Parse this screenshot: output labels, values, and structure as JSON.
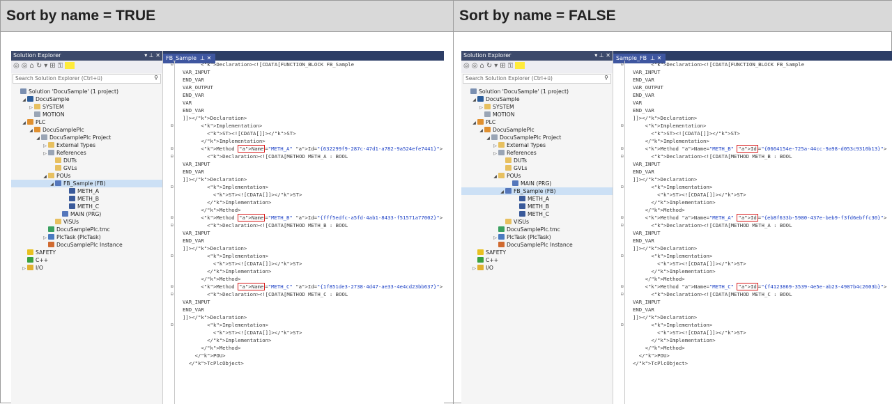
{
  "left": {
    "header": "Sort by name = TRUE",
    "explorer": {
      "title": "Solution Explorer",
      "title_controls": "▾ ⊥ ✕",
      "search_placeholder": "Search Solution Explorer (Ctrl+ü)",
      "items": [
        {
          "label": "Solution 'DocuSample' (1 project)",
          "indent": 0,
          "arrow": "",
          "icon": "solution-icon",
          "cls": "ic-sol"
        },
        {
          "label": "DocuSample",
          "indent": 1,
          "arrow": "◢",
          "icon": "project-icon",
          "cls": "ic-proj"
        },
        {
          "label": "SYSTEM",
          "indent": 2,
          "arrow": "▷",
          "icon": "system-icon",
          "cls": "ic-fold"
        },
        {
          "label": "MOTION",
          "indent": 2,
          "arrow": "",
          "icon": "motion-icon",
          "cls": "ic-gray"
        },
        {
          "label": "PLC",
          "indent": 1,
          "arrow": "◢",
          "icon": "plc-icon",
          "cls": "ic-plc"
        },
        {
          "label": "DocuSamplePlc",
          "indent": 2,
          "arrow": "◢",
          "icon": "plc-project-icon",
          "cls": "ic-plc"
        },
        {
          "label": "DocuSamplePlc Project",
          "indent": 3,
          "arrow": "◢",
          "icon": "project-file-icon",
          "cls": "ic-gray"
        },
        {
          "label": "External Types",
          "indent": 4,
          "arrow": "▷",
          "icon": "folder-icon",
          "cls": "ic-fold"
        },
        {
          "label": "References",
          "indent": 4,
          "arrow": "▷",
          "icon": "references-icon",
          "cls": "ic-gray"
        },
        {
          "label": "DUTs",
          "indent": 5,
          "arrow": "",
          "icon": "folder-icon",
          "cls": "ic-fold"
        },
        {
          "label": "GVLs",
          "indent": 5,
          "arrow": "",
          "icon": "folder-icon",
          "cls": "ic-fold"
        },
        {
          "label": "POUs",
          "indent": 4,
          "arrow": "◢",
          "icon": "folder-open-icon",
          "cls": "ic-fold"
        },
        {
          "label": "FB_Sample (FB)",
          "indent": 5,
          "arrow": "◢",
          "icon": "function-block-icon",
          "cls": "ic-fb",
          "selected": true
        },
        {
          "label": "METH_A",
          "indent": 7,
          "arrow": "",
          "icon": "method-icon",
          "cls": "ic-m"
        },
        {
          "label": "METH_B",
          "indent": 7,
          "arrow": "",
          "icon": "method-icon",
          "cls": "ic-m"
        },
        {
          "label": "METH_C",
          "indent": 7,
          "arrow": "",
          "icon": "method-icon",
          "cls": "ic-m"
        },
        {
          "label": "MAIN (PRG)",
          "indent": 6,
          "arrow": "",
          "icon": "program-icon",
          "cls": "ic-fb"
        },
        {
          "label": "VISUs",
          "indent": 5,
          "arrow": "",
          "icon": "folder-icon",
          "cls": "ic-fold"
        },
        {
          "label": "DocuSamplePlc.tmc",
          "indent": 4,
          "arrow": "",
          "icon": "tmc-icon",
          "cls": "ic-tmc"
        },
        {
          "label": "PlcTask (PlcTask)",
          "indent": 4,
          "arrow": "▷",
          "icon": "task-icon",
          "cls": "ic-task"
        },
        {
          "label": "DocuSamplePlc Instance",
          "indent": 4,
          "arrow": "",
          "icon": "instance-icon",
          "cls": "ic-inst"
        },
        {
          "label": "SAFETY",
          "indent": 1,
          "arrow": "",
          "icon": "safety-icon",
          "cls": "ic-safe"
        },
        {
          "label": "C++",
          "indent": 1,
          "arrow": "",
          "icon": "cpp-icon",
          "cls": "ic-cpp"
        },
        {
          "label": "I/O",
          "indent": 1,
          "arrow": "▷",
          "icon": "io-icon",
          "cls": "ic-io"
        }
      ]
    },
    "editor": {
      "tab": "FB_Sample",
      "tab_controls": "⊥ ✕",
      "lines": [
        {
          "t": "      <Declaration><![CDATA[FUNCTION_BLOCK FB_Sample",
          "m": "⊟"
        },
        {
          "t": "VAR_INPUT",
          "m": ""
        },
        {
          "t": "END_VAR",
          "m": ""
        },
        {
          "t": "VAR_OUTPUT",
          "m": ""
        },
        {
          "t": "END_VAR",
          "m": ""
        },
        {
          "t": "VAR",
          "m": ""
        },
        {
          "t": "END_VAR",
          "m": ""
        },
        {
          "t": "]]></Declaration>",
          "m": ""
        },
        {
          "t": "      <Implementation>",
          "m": "⊟"
        },
        {
          "t": "        <ST><![CDATA[]]></ST>",
          "m": ""
        },
        {
          "t": "      </Implementation>",
          "m": ""
        },
        {
          "t": "      <Method Name=\"METH_A\" Id=\"{632299f9-287c-47d1-a782-9a524efe7441}\">",
          "m": "⊟",
          "box": "Name=\"METH_A\""
        },
        {
          "t": "        <Declaration><![CDATA[METHOD METH_A : BOOL",
          "m": "⊟"
        },
        {
          "t": "VAR_INPUT",
          "m": ""
        },
        {
          "t": "END_VAR",
          "m": ""
        },
        {
          "t": "]]></Declaration>",
          "m": ""
        },
        {
          "t": "        <Implementation>",
          "m": "⊟"
        },
        {
          "t": "          <ST><![CDATA[]]></ST>",
          "m": ""
        },
        {
          "t": "        </Implementation>",
          "m": ""
        },
        {
          "t": "      </Method>",
          "m": ""
        },
        {
          "t": "      <Method Name=\"METH_B\" Id=\"{fff5edfc-a5fd-4ab1-8433-f51571a77002}\">",
          "m": "⊟",
          "box": "Name=\"METH_B\""
        },
        {
          "t": "        <Declaration><![CDATA[METHOD METH_B : BOOL",
          "m": "⊟"
        },
        {
          "t": "VAR_INPUT",
          "m": ""
        },
        {
          "t": "END_VAR",
          "m": ""
        },
        {
          "t": "]]></Declaration>",
          "m": ""
        },
        {
          "t": "        <Implementation>",
          "m": "⊟"
        },
        {
          "t": "          <ST><![CDATA[]]></ST>",
          "m": ""
        },
        {
          "t": "        </Implementation>",
          "m": ""
        },
        {
          "t": "      </Method>",
          "m": ""
        },
        {
          "t": "      <Method Name=\"METH_C\" Id=\"{1f851de3-2738-4d47-ae33-4e4cd23bb637}\">",
          "m": "⊟",
          "box": "Name=\"METH_C\""
        },
        {
          "t": "        <Declaration><![CDATA[METHOD METH_C : BOOL",
          "m": "⊟"
        },
        {
          "t": "VAR_INPUT",
          "m": ""
        },
        {
          "t": "END_VAR",
          "m": ""
        },
        {
          "t": "]]></Declaration>",
          "m": ""
        },
        {
          "t": "        <Implementation>",
          "m": "⊟"
        },
        {
          "t": "          <ST><![CDATA[]]></ST>",
          "m": ""
        },
        {
          "t": "        </Implementation>",
          "m": ""
        },
        {
          "t": "      </Method>",
          "m": ""
        },
        {
          "t": "    </POU>",
          "m": ""
        },
        {
          "t": "  </TcPlcObject>",
          "m": ""
        }
      ]
    }
  },
  "right": {
    "header": "Sort by name = FALSE",
    "explorer": {
      "title": "Solution Explorer",
      "title_controls": "▾ ⊥ ✕",
      "search_placeholder": "Search Solution Explorer (Ctrl+ü)",
      "items": [
        {
          "label": "Solution 'DocuSample' (1 project)",
          "indent": 0,
          "arrow": "",
          "icon": "solution-icon",
          "cls": "ic-sol"
        },
        {
          "label": "DocuSample",
          "indent": 1,
          "arrow": "◢",
          "icon": "project-icon",
          "cls": "ic-proj"
        },
        {
          "label": "SYSTEM",
          "indent": 2,
          "arrow": "▷",
          "icon": "system-icon",
          "cls": "ic-fold"
        },
        {
          "label": "MOTION",
          "indent": 2,
          "arrow": "",
          "icon": "motion-icon",
          "cls": "ic-gray"
        },
        {
          "label": "PLC",
          "indent": 1,
          "arrow": "◢",
          "icon": "plc-icon",
          "cls": "ic-plc"
        },
        {
          "label": "DocuSamplePlc",
          "indent": 2,
          "arrow": "◢",
          "icon": "plc-project-icon",
          "cls": "ic-plc"
        },
        {
          "label": "DocuSamplePlc Project",
          "indent": 3,
          "arrow": "◢",
          "icon": "project-file-icon",
          "cls": "ic-gray"
        },
        {
          "label": "External Types",
          "indent": 4,
          "arrow": "▷",
          "icon": "folder-icon",
          "cls": "ic-fold"
        },
        {
          "label": "References",
          "indent": 4,
          "arrow": "▷",
          "icon": "references-icon",
          "cls": "ic-gray"
        },
        {
          "label": "DUTs",
          "indent": 5,
          "arrow": "",
          "icon": "folder-icon",
          "cls": "ic-fold"
        },
        {
          "label": "GVLs",
          "indent": 5,
          "arrow": "",
          "icon": "folder-icon",
          "cls": "ic-fold"
        },
        {
          "label": "POUs",
          "indent": 4,
          "arrow": "◢",
          "icon": "folder-open-icon",
          "cls": "ic-fold"
        },
        {
          "label": "MAIN (PRG)",
          "indent": 6,
          "arrow": "",
          "icon": "program-icon",
          "cls": "ic-fb"
        },
        {
          "label": "FB_Sample (FB)",
          "indent": 5,
          "arrow": "◢",
          "icon": "function-block-icon",
          "cls": "ic-fb",
          "selected": true
        },
        {
          "label": "METH_A",
          "indent": 7,
          "arrow": "",
          "icon": "method-icon",
          "cls": "ic-m"
        },
        {
          "label": "METH_B",
          "indent": 7,
          "arrow": "",
          "icon": "method-icon",
          "cls": "ic-m"
        },
        {
          "label": "METH_C",
          "indent": 7,
          "arrow": "",
          "icon": "method-icon",
          "cls": "ic-m"
        },
        {
          "label": "VISUs",
          "indent": 5,
          "arrow": "",
          "icon": "folder-icon",
          "cls": "ic-fold"
        },
        {
          "label": "DocuSamplePlc.tmc",
          "indent": 4,
          "arrow": "",
          "icon": "tmc-icon",
          "cls": "ic-tmc"
        },
        {
          "label": "PlcTask (PlcTask)",
          "indent": 4,
          "arrow": "▷",
          "icon": "task-icon",
          "cls": "ic-task"
        },
        {
          "label": "DocuSamplePlc Instance",
          "indent": 4,
          "arrow": "",
          "icon": "instance-icon",
          "cls": "ic-inst"
        },
        {
          "label": "SAFETY",
          "indent": 1,
          "arrow": "",
          "icon": "safety-icon",
          "cls": "ic-safe"
        },
        {
          "label": "C++",
          "indent": 1,
          "arrow": "",
          "icon": "cpp-icon",
          "cls": "ic-cpp"
        },
        {
          "label": "I/O",
          "indent": 1,
          "arrow": "▷",
          "icon": "io-icon",
          "cls": "ic-io"
        }
      ]
    },
    "editor": {
      "tab": "Sample_FB",
      "tab_controls": "⊥ ✕",
      "lines": [
        {
          "t": "      <Declaration><![CDATA[FUNCTION_BLOCK FB_Sample",
          "m": "⊟"
        },
        {
          "t": "VAR_INPUT",
          "m": ""
        },
        {
          "t": "END_VAR",
          "m": ""
        },
        {
          "t": "VAR_OUTPUT",
          "m": ""
        },
        {
          "t": "END_VAR",
          "m": ""
        },
        {
          "t": "VAR",
          "m": ""
        },
        {
          "t": "END_VAR",
          "m": ""
        },
        {
          "t": "]]></Declaration>",
          "m": ""
        },
        {
          "t": "    <Implementation>",
          "m": "⊟"
        },
        {
          "t": "      <ST><![CDATA[]]></ST>",
          "m": ""
        },
        {
          "t": "    </Implementation>",
          "m": ""
        },
        {
          "t": "    <Method Name=\"METH_B\" Id=\"{0664154e-725a-44cc-9a98-d053c9310b13}\">",
          "m": "⊟",
          "box": "Id=\"{0664154e-725a-44cc-9a98-d053c9310b13}\">"
        },
        {
          "t": "      <Declaration><![CDATA[METHOD METH_B : BOOL",
          "m": "⊟"
        },
        {
          "t": "VAR_INPUT",
          "m": ""
        },
        {
          "t": "END_VAR",
          "m": ""
        },
        {
          "t": "]]></Declaration>",
          "m": ""
        },
        {
          "t": "      <Implementation>",
          "m": "⊟"
        },
        {
          "t": "        <ST><![CDATA[]]></ST>",
          "m": ""
        },
        {
          "t": "      </Implementation>",
          "m": ""
        },
        {
          "t": "    </Method>",
          "m": ""
        },
        {
          "t": "    <Method Name=\"METH_A\" Id=\"{eb8f633b-5980-437e-beb9-f3fd6ebffc30}\">",
          "m": "⊟",
          "box": "Id=\"{eb8f633b-5980-437e-beb9-f3fd6ebffc30}\">"
        },
        {
          "t": "      <Declaration><![CDATA[METHOD METH_A : BOOL",
          "m": "⊟"
        },
        {
          "t": "VAR_INPUT",
          "m": ""
        },
        {
          "t": "END_VAR",
          "m": ""
        },
        {
          "t": "]]></Declaration>",
          "m": ""
        },
        {
          "t": "      <Implementation>",
          "m": "⊟"
        },
        {
          "t": "        <ST><![CDATA[]]></ST>",
          "m": ""
        },
        {
          "t": "      </Implementation>",
          "m": ""
        },
        {
          "t": "    </Method>",
          "m": ""
        },
        {
          "t": "    <Method Name=\"METH_C\" Id=\"{f4123869-3539-4e5e-ab23-4987b4c2603b}\">",
          "m": "⊟",
          "box": "Id=\"{f4123869-3539-4e5e-ab23-4987b4c2603b}\">"
        },
        {
          "t": "      <Declaration><![CDATA[METHOD METH_C : BOOL",
          "m": "⊟"
        },
        {
          "t": "VAR_INPUT",
          "m": ""
        },
        {
          "t": "END_VAR",
          "m": ""
        },
        {
          "t": "]]></Declaration>",
          "m": ""
        },
        {
          "t": "      <Implementation>",
          "m": "⊟"
        },
        {
          "t": "        <ST><![CDATA[]]></ST>",
          "m": ""
        },
        {
          "t": "      </Implementation>",
          "m": ""
        },
        {
          "t": "    </Method>",
          "m": ""
        },
        {
          "t": "  </POU>",
          "m": ""
        },
        {
          "t": "</TcPlcObject>",
          "m": ""
        }
      ]
    }
  }
}
